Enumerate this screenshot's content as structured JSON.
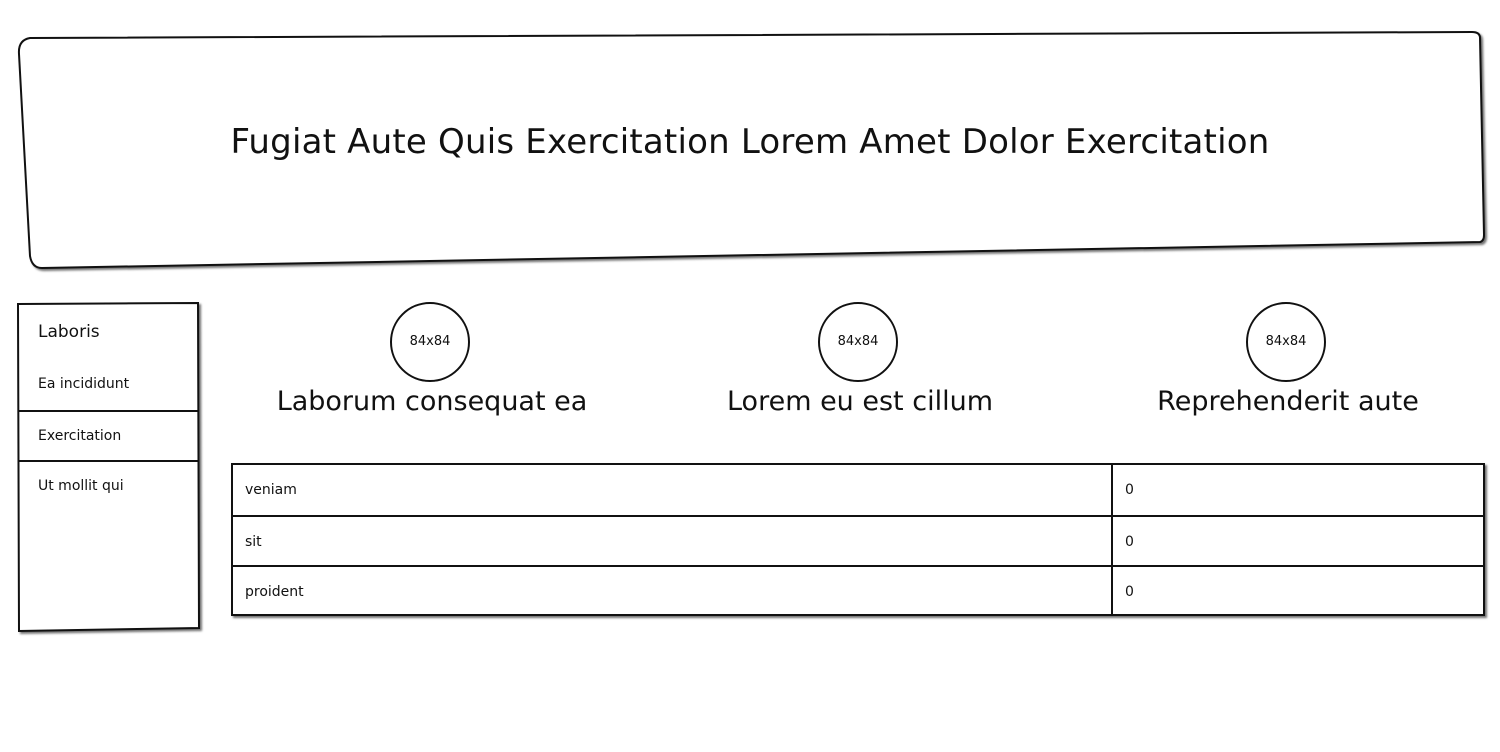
{
  "header": {
    "title": "Fugiat Aute Quis Exercitation Lorem Amet Dolor Exercitation"
  },
  "sidebar": {
    "header": "Laboris",
    "items": [
      {
        "label": "Ea incididunt"
      },
      {
        "label": "Exercitation"
      },
      {
        "label": "Ut mollit qui"
      }
    ]
  },
  "features": [
    {
      "image_label": "84x84",
      "caption": "Laborum consequat ea"
    },
    {
      "image_label": "84x84",
      "caption": "Lorem eu est cillum"
    },
    {
      "image_label": "84x84",
      "caption": "Reprehenderit aute"
    }
  ],
  "table": {
    "rows": [
      {
        "name": "veniam",
        "value": "0"
      },
      {
        "name": "sit",
        "value": "0"
      },
      {
        "name": "proident",
        "value": "0"
      }
    ]
  }
}
